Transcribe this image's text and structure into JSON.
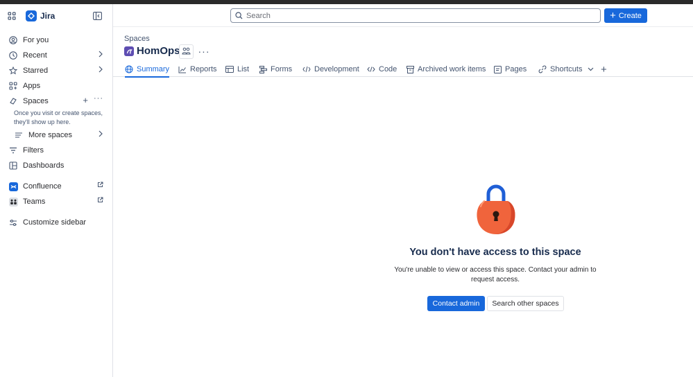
{
  "brand": {
    "name": "Jira"
  },
  "sidebar": {
    "items": [
      {
        "label": "For you",
        "icon": "user-circle-icon"
      },
      {
        "label": "Recent",
        "icon": "clock-icon"
      },
      {
        "label": "Starred",
        "icon": "star-icon"
      },
      {
        "label": "Apps",
        "icon": "apps-icon"
      },
      {
        "label": "Spaces",
        "icon": "spaces-icon"
      },
      {
        "label": "More spaces",
        "icon": "list-icon"
      },
      {
        "label": "Filters",
        "icon": "filter-icon"
      },
      {
        "label": "Dashboards",
        "icon": "dashboard-icon"
      },
      {
        "label": "Confluence",
        "icon": "confluence-icon"
      },
      {
        "label": "Teams",
        "icon": "teams-icon"
      },
      {
        "label": "Customize sidebar",
        "icon": "sliders-icon"
      }
    ],
    "spaces_hint": "Once you visit or create spaces, they'll show up here."
  },
  "header": {
    "search_placeholder": "Search",
    "create_label": "Create"
  },
  "space": {
    "breadcrumb": "Spaces",
    "title": "HomOps"
  },
  "tabs": [
    {
      "label": "Summary",
      "active": true
    },
    {
      "label": "Reports"
    },
    {
      "label": "List"
    },
    {
      "label": "Forms"
    },
    {
      "label": "Development"
    },
    {
      "label": "Code"
    },
    {
      "label": "Archived work items"
    },
    {
      "label": "Pages"
    },
    {
      "label": "Shortcuts"
    }
  ],
  "empty_state": {
    "title": "You don't have access to this space",
    "body": "You're unable to view or access this space. Contact your admin to request access.",
    "primary_button": "Contact admin",
    "secondary_button": "Search other spaces"
  },
  "colors": {
    "accent": "#1868db",
    "lock_body": "#f0643c",
    "lock_shackle": "#1f5fd6"
  }
}
